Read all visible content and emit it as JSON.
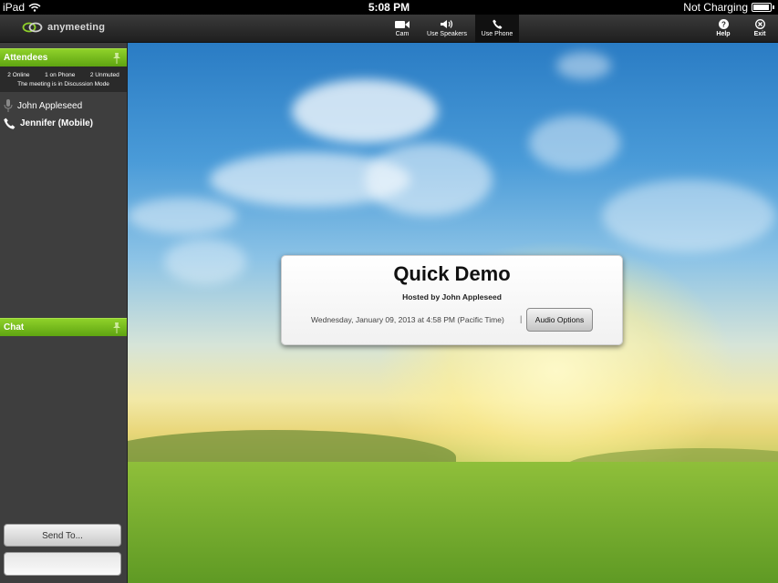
{
  "statusbar": {
    "device": "iPad",
    "time": "5:08 PM",
    "battery_status": "Not Charging"
  },
  "app": {
    "logo_text": "anymeeting"
  },
  "toolbar": {
    "buttons": [
      {
        "label": "Cam",
        "icon": "camera-icon"
      },
      {
        "label": "Use Speakers",
        "icon": "speaker-icon"
      },
      {
        "label": "Use Phone",
        "icon": "phone-icon",
        "active": true
      }
    ],
    "help_label": "Help",
    "exit_label": "Exit"
  },
  "attendees_panel": {
    "title": "Attendees",
    "stats": {
      "online": "2 Online",
      "on_phone": "1 on Phone",
      "unmuted": "2 Unmuted",
      "mode": "The meeting is in Discussion Mode"
    },
    "list": [
      {
        "name": "John Appleseed",
        "icon": "microphone-icon"
      },
      {
        "name": "Jennifer (Mobile)",
        "icon": "phone-icon"
      }
    ]
  },
  "chat_panel": {
    "title": "Chat",
    "send_to_label": "Send To...",
    "input_value": ""
  },
  "meeting": {
    "title": "Quick Demo",
    "host": "Hosted by John Appleseed",
    "datetime": "Wednesday, January 09, 2013 at 4:58 PM (Pacific Time)",
    "separator": "|",
    "audio_options_label": "Audio Options"
  },
  "colors": {
    "accent_green": "#6cb51a",
    "toolbar_dark": "#2a2a2a",
    "sidebar_gray": "#3e3e3e"
  }
}
